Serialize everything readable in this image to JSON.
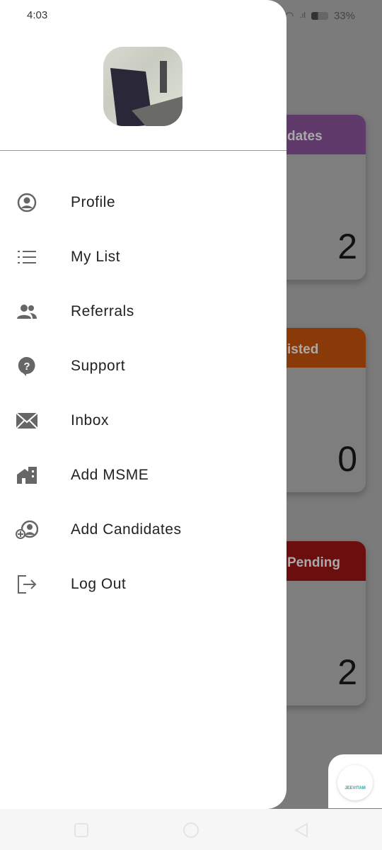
{
  "status_bar": {
    "time": "4:03",
    "battery": "33%"
  },
  "background": {
    "cards": [
      {
        "title": "dates",
        "value": "2",
        "color": "#613a6c"
      },
      {
        "title": "isted",
        "value": "0",
        "color": "#8a3a08"
      },
      {
        "title": "Pending",
        "value": "2",
        "color": "#6a0e0e"
      }
    ]
  },
  "drawer": {
    "items": [
      {
        "label": "Profile",
        "icon": "account-circle-icon"
      },
      {
        "label": "My List",
        "icon": "list-icon"
      },
      {
        "label": "Referrals",
        "icon": "people-icon"
      },
      {
        "label": "Support",
        "icon": "help-icon"
      },
      {
        "label": "Inbox",
        "icon": "mail-icon"
      },
      {
        "label": "Add MSME",
        "icon": "business-icon"
      },
      {
        "label": "Add Candidates",
        "icon": "add-person-icon"
      },
      {
        "label": "Log Out",
        "icon": "logout-icon"
      }
    ]
  },
  "fab": {
    "logo_text": "JEEVITAM"
  }
}
